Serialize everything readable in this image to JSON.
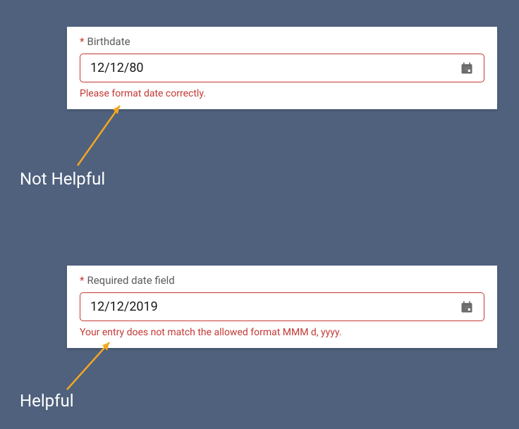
{
  "example1": {
    "label": "Birthdate",
    "value": "12/12/80",
    "error": "Please format date correctly.",
    "caption": "Not Helpful"
  },
  "example2": {
    "label": "Required date field",
    "value": "12/12/2019",
    "error": "Your entry does not match the allowed format MMM d, yyyy.",
    "caption": "Helpful"
  }
}
